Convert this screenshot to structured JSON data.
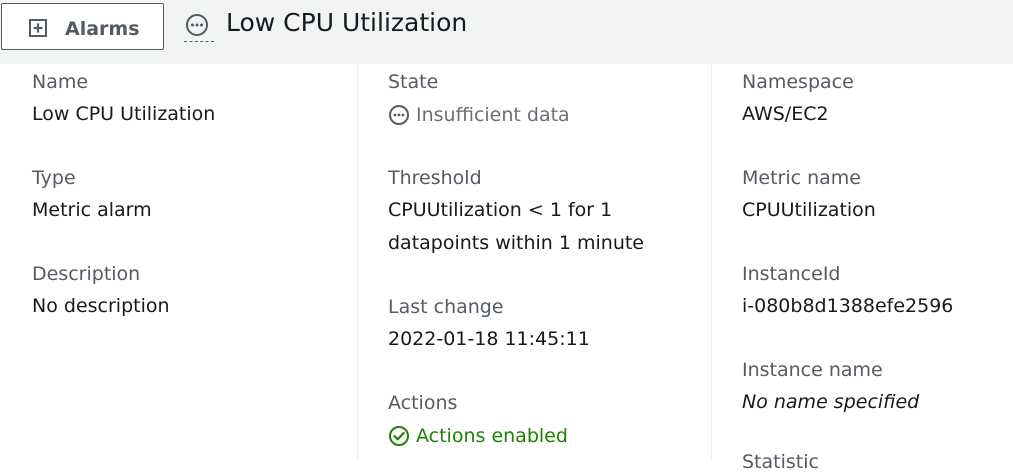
{
  "header": {
    "alarms_button_label": "Alarms",
    "title": "Low CPU Utilization"
  },
  "col1": {
    "name_label": "Name",
    "name_value": "Low CPU Utilization",
    "type_label": "Type",
    "type_value": "Metric alarm",
    "description_label": "Description",
    "description_value": "No description"
  },
  "col2": {
    "state_label": "State",
    "state_value": "Insufficient data",
    "threshold_label": "Threshold",
    "threshold_line1": "CPUUtilization < 1 for 1",
    "threshold_line2": "datapoints within 1 minute",
    "last_change_label": "Last change",
    "last_change_value": "2022-01-18 11:45:11",
    "actions_label": "Actions",
    "actions_value": "Actions enabled"
  },
  "col3": {
    "namespace_label": "Namespace",
    "namespace_value": "AWS/EC2",
    "metric_name_label": "Metric name",
    "metric_name_value": "CPUUtilization",
    "instance_id_label": "InstanceId",
    "instance_id_value": "i-080b8d1388efe2596",
    "instance_name_label": "Instance name",
    "instance_name_value": "No name specified",
    "partial_label": "Statistic"
  },
  "colors": {
    "status_gray": "#687078",
    "status_green": "#1d8102",
    "label": "#545b64",
    "value": "#16191f"
  }
}
